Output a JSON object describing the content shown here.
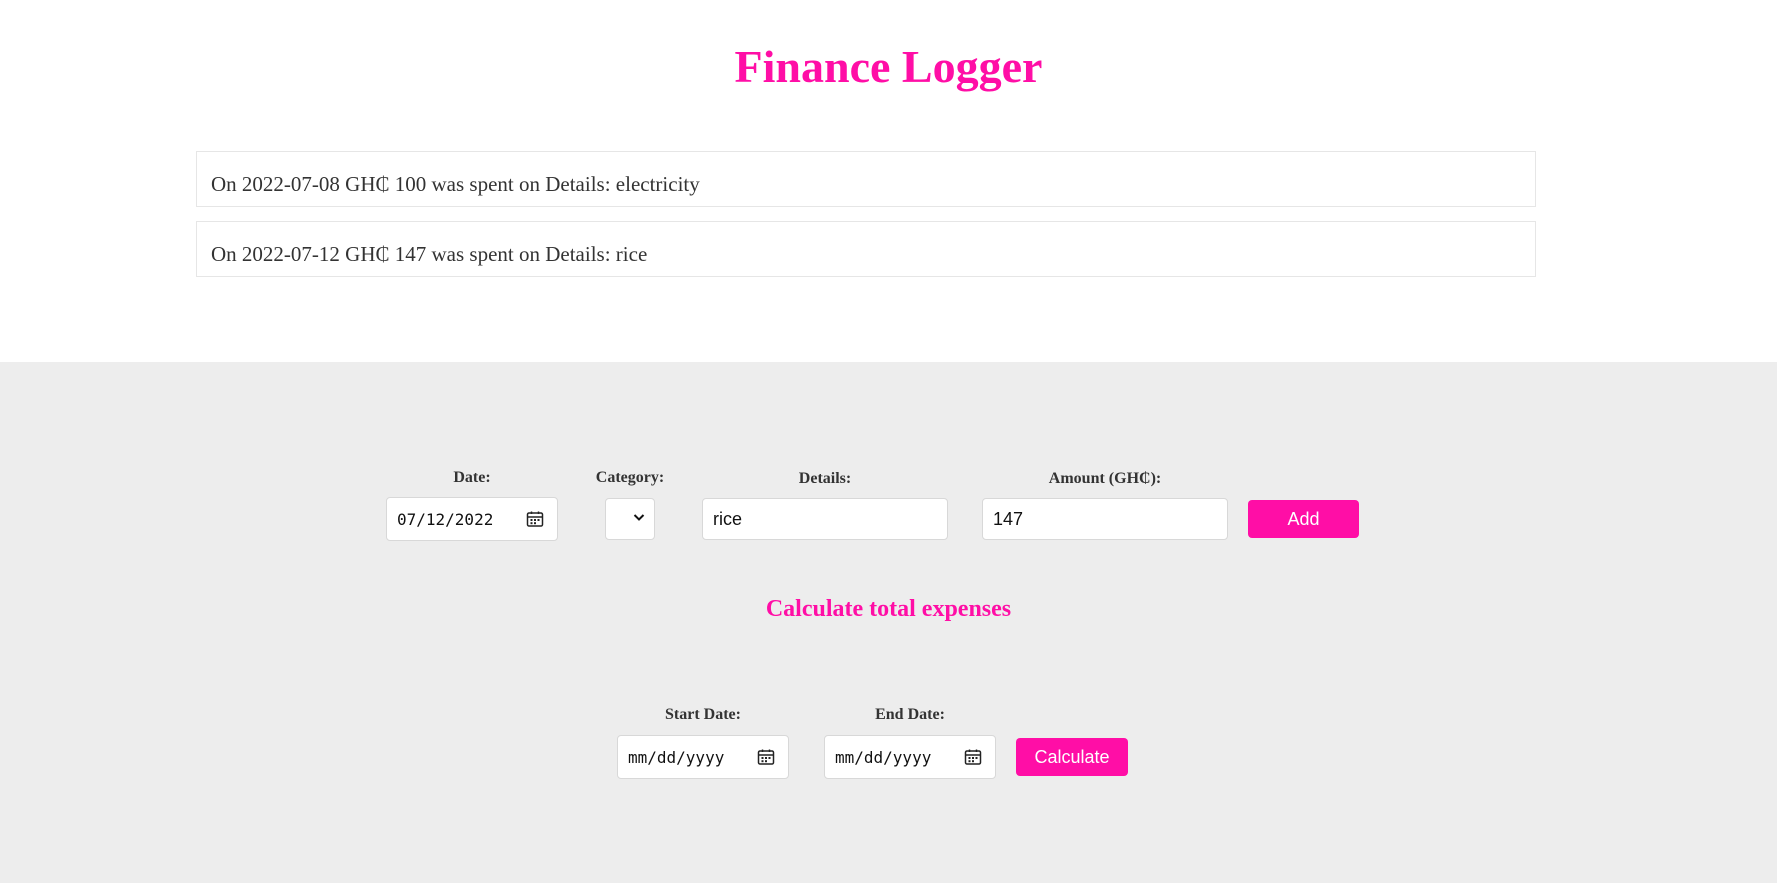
{
  "app": {
    "title": "Finance Logger"
  },
  "entries": [
    {
      "text": "On 2022-07-08 GH₵ 100 was spent on Details: electricity"
    },
    {
      "text": "On 2022-07-12 GH₵ 147 was spent on Details: rice"
    }
  ],
  "form": {
    "date_label": "Date:",
    "date_value": "07/12/2022",
    "category_label": "Category:",
    "category_value": "",
    "details_label": "Details:",
    "details_value": "rice",
    "amount_label": "Amount (GH₵):",
    "amount_value": "147",
    "add_label": "Add"
  },
  "calculate": {
    "heading": "Calculate total expenses",
    "start_label": "Start Date:",
    "start_value": "mm/dd/yyyy",
    "end_label": "End Date:",
    "end_value": "mm/dd/yyyy",
    "button_label": "Calculate"
  },
  "colors": {
    "accent": "#ff0ea6",
    "panel_bg": "#ededed",
    "text": "#333333"
  },
  "icons": {
    "date_picker": "calendar-icon",
    "select": "chevron-down-icon"
  }
}
